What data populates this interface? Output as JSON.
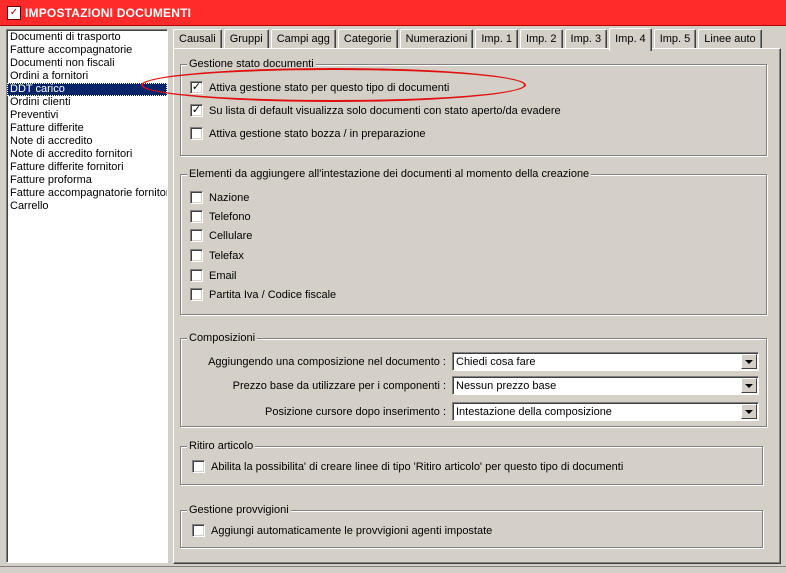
{
  "window": {
    "title": "IMPOSTAZIONI DOCUMENTI"
  },
  "doc_list": {
    "items": [
      "Documenti di trasporto",
      "Fatture accompagnatorie",
      "Documenti non fiscali",
      "Ordini a fornitori",
      "DDT carico",
      "Ordini clienti",
      "Preventivi",
      "Fatture differite",
      "Note di accredito",
      "Note di accredito fornitori",
      "Fatture differite fornitori",
      "Fatture proforma",
      "Fatture accompagnatorie fornitori",
      "Carrello"
    ],
    "selected": "DDT carico"
  },
  "tabs": [
    "Causali",
    "Gruppi",
    "Campi agg",
    "Categorie",
    "Numerazioni",
    "Imp. 1",
    "Imp. 2",
    "Imp. 3",
    "Imp. 4",
    "Imp. 5",
    "Linee auto"
  ],
  "active_tab": "Imp. 4",
  "stato": {
    "legend": "Gestione stato documenti",
    "options": [
      {
        "label": "Attiva gestione stato per questo tipo di documenti",
        "checked": true
      },
      {
        "label": "Su lista di default visualizza solo documenti con stato aperto/da evadere",
        "checked": true
      },
      {
        "label": "Attiva gestione stato bozza / in preparazione",
        "checked": false
      }
    ]
  },
  "intestazione": {
    "legend": "Elementi da aggiungere all'intestazione dei documenti al momento della creazione",
    "options": [
      {
        "label": "Nazione",
        "checked": false
      },
      {
        "label": "Telefono",
        "checked": false
      },
      {
        "label": "Cellulare",
        "checked": false
      },
      {
        "label": "Telefax",
        "checked": false
      },
      {
        "label": "Email",
        "checked": false
      },
      {
        "label": "Partita Iva / Codice fiscale",
        "checked": false
      }
    ]
  },
  "composizioni": {
    "legend": "Composizioni",
    "fields": [
      {
        "label": "Aggiungendo una composizione nel documento :",
        "value": "Chiedi cosa fare"
      },
      {
        "label": "Prezzo base da utilizzare per i componenti :",
        "value": "Nessun prezzo base"
      },
      {
        "label": "Posizione cursore dopo inserimento :",
        "value": "Intestazione della composizione"
      }
    ]
  },
  "ritiro": {
    "legend": "Ritiro articolo",
    "option": {
      "label": "Abilita la possibilita' di creare linee di tipo 'Ritiro articolo' per questo tipo di documenti",
      "checked": false
    }
  },
  "provvigioni": {
    "legend": "Gestione provvigioni",
    "option": {
      "label": "Aggiungi automaticamente le provvigioni agenti impostate",
      "checked": false
    }
  },
  "colors": {
    "title_bar": "#ff2b2b",
    "selection": "#0a246a",
    "highlight": "#e01010"
  }
}
